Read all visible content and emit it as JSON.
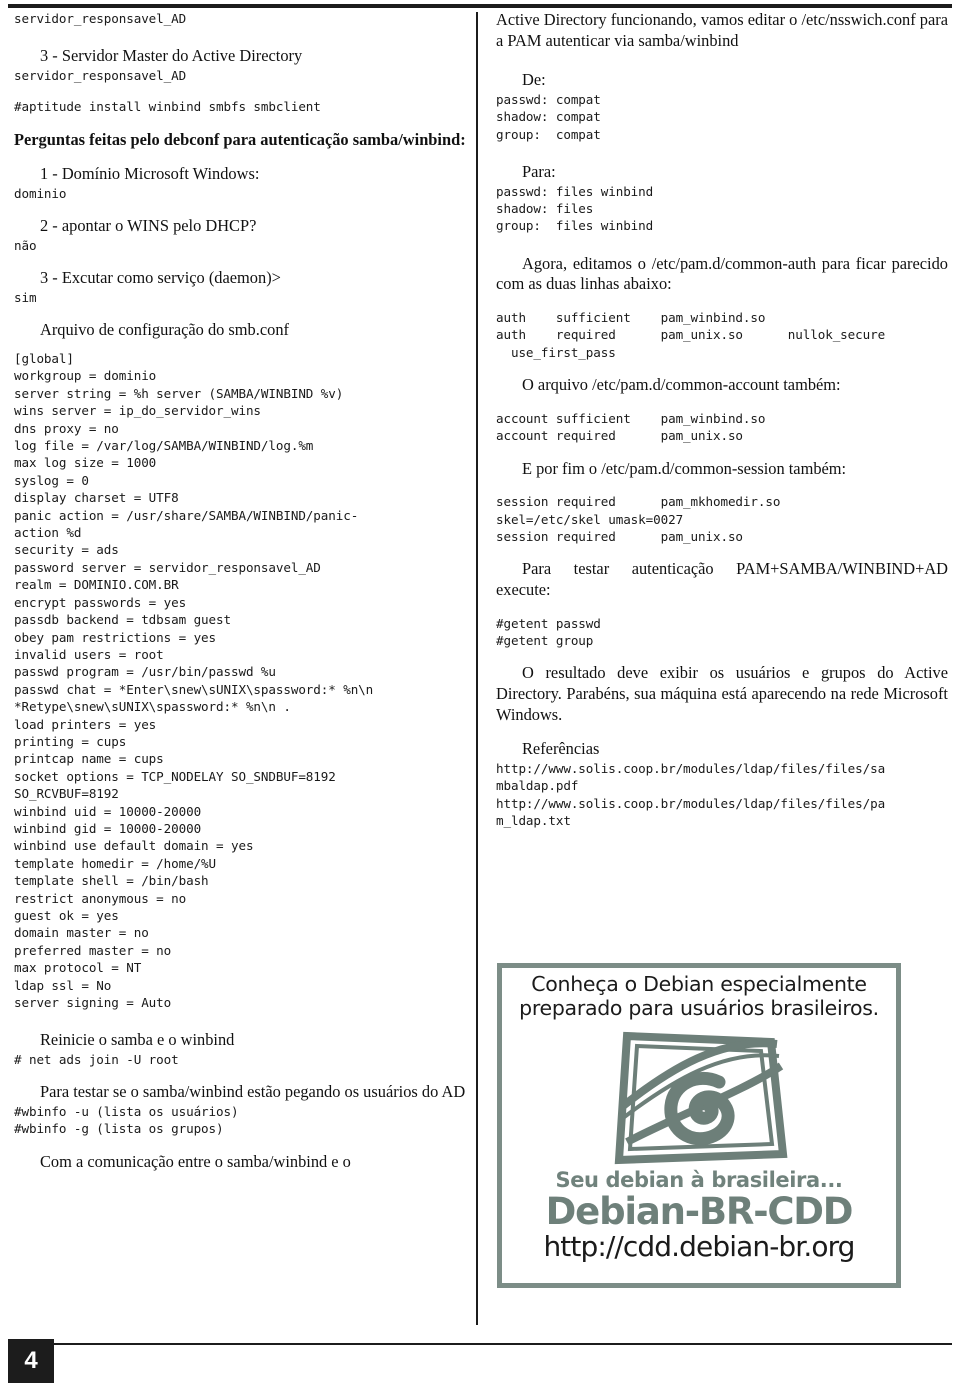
{
  "document": {
    "page_number": "4",
    "colors": {
      "rule": "#1c1c1c",
      "text": "#111111",
      "ad_frame": "#7c8d87",
      "ad_brand": "#6e807a",
      "ad_tagline": "#70827c",
      "logo": "#6d7f79"
    }
  },
  "left_column": {
    "l01_server_name": "servidor_responsavel_AD",
    "l02_heading_master": "3 - Servidor Master do Active Directory",
    "l03_server_name2": "servidor_responsavel_AD",
    "l04_cmd_aptitude": "#aptitude install winbind smbfs smbclient",
    "l05_heading_debconf": "Perguntas feitas pelo debconf para autenticação samba/winbind:",
    "l06_q1": "1 - Domínio Microsoft Windows:",
    "l07_a1": "dominio",
    "l08_q2": "2 - apontar o WINS pelo DHCP?",
    "l09_a2": "não",
    "l10_q3": "3 - Excutar como serviço (daemon)>",
    "l11_a3": "sim",
    "l12_heading_smbconf": "Arquivo de configuração do smb.conf",
    "l13_smb_conf": "[global]\nworkgroup = dominio\nserver string = %h server (SAMBA/WINBIND %v)\nwins server = ip_do_servidor_wins\ndns proxy = no\nlog file = /var/log/SAMBA/WINBIND/log.%m\nmax log size = 1000\nsyslog = 0\ndisplay charset = UTF8\npanic action = /usr/share/SAMBA/WINBIND/panic-\naction %d\nsecurity = ads\npassword server = servidor_responsavel_AD\nrealm = DOMINIO.COM.BR\nencrypt passwords = yes\npassdb backend = tdbsam guest\nobey pam restrictions = yes\ninvalid users = root\npasswd program = /usr/bin/passwd %u\npasswd chat = *Enter\\snew\\sUNIX\\spassword:* %n\\n\n*Retype\\snew\\sUNIX\\spassword:* %n\\n .\nload printers = yes\nprinting = cups\nprintcap name = cups\nsocket options = TCP_NODELAY SO_SNDBUF=8192\nSO_RCVBUF=8192\nwinbind uid = 10000-20000\nwinbind gid = 10000-20000\nwinbind use default domain = yes\ntemplate homedir = /home/%U\ntemplate shell = /bin/bash\nrestrict anonymous = no\nguest ok = yes\ndomain master = no\npreferred master = no\nmax protocol = NT\nldap ssl = No\nserver signing = Auto",
    "l14_heading_reinicie": "Reinicie o samba e o winbind",
    "l15_cmd_netads": "# net ads join -U root",
    "l16_para_testar": "Para testar se o samba/winbind estão pegando os usuários do AD",
    "l17_cmd_wbinfo": "#wbinfo -u (lista os usuários)\n#wbinfo -g (lista os grupos)",
    "l18_para_com": "Com a comunicação entre o samba/winbind e o"
  },
  "right_column": {
    "r01_para_ad": "Active Directory funcionando, vamos editar o /etc/nsswich.conf para a PAM autenticar via samba/winbind",
    "r02_heading_de": "De:",
    "r03_block_de": "passwd: compat\nshadow: compat\ngroup:  compat",
    "r04_heading_para": "Para:",
    "r05_block_para": "passwd: files winbind\nshadow: files\ngroup:  files winbind",
    "r06_para_agora": "Agora, editamos o /etc/pam.d/common-auth para ficar parecido com as duas linhas abaixo:",
    "r07_block_auth": "auth    sufficient    pam_winbind.so\nauth    required      pam_unix.so      nullok_secure\n  use_first_pass",
    "r08_heading_account": "O arquivo /etc/pam.d/common-account também:",
    "r09_block_account": "account sufficient    pam_winbind.so\naccount required      pam_unix.so",
    "r10_heading_session": "E por fim o /etc/pam.d/common-session também:",
    "r11_block_session": "session required      pam_mkhomedir.so\nskel=/etc/skel umask=0027\nsession required      pam_unix.so",
    "r12_para_testar": "Para testar autenticação PAM+SAMBA/WINBIND+AD execute:",
    "r13_block_getent": "#getent passwd\n#getent group",
    "r14_para_resultado": "O resultado deve exibir os usuários e grupos do Active Directory. Parabéns, sua máquina está aparecendo na rede Microsoft Windows.",
    "r15_heading_referencias": "Referências",
    "r16_block_refs": "http://www.solis.coop.br/modules/ldap/files/files/sa\nmbaldap.pdf\nhttp://www.solis.coop.br/modules/ldap/files/files/pa\nm_ldap.txt"
  },
  "ad": {
    "headline": "Conheça o Debian especialmente preparado para usuários brasileiros.",
    "tagline": "Seu debian à brasileira...",
    "brand": "Debian-BR-CDD",
    "url": "http://cdd.debian-br.org"
  }
}
